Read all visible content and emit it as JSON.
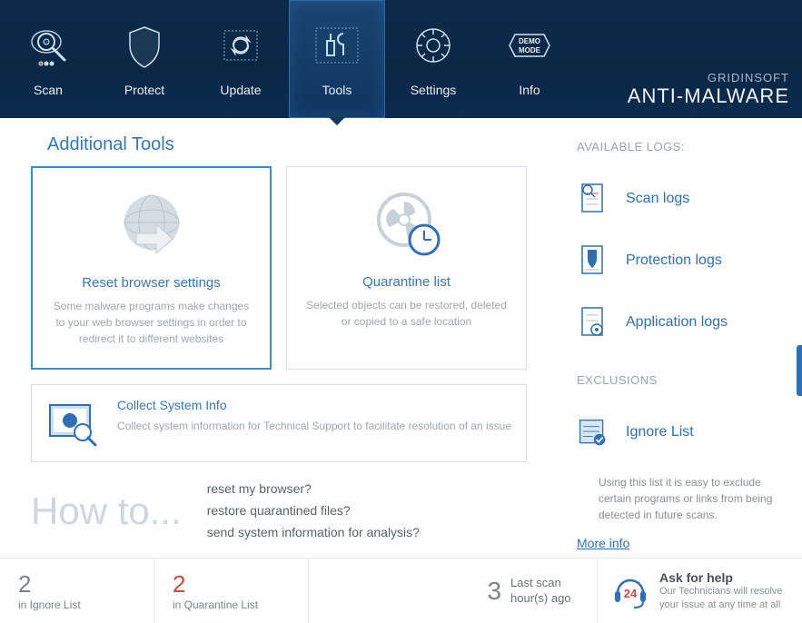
{
  "brand": {
    "company": "GRIDINSOFT",
    "product": "ANTI-MALWARE"
  },
  "nav": [
    {
      "label": "Scan"
    },
    {
      "label": "Protect"
    },
    {
      "label": "Update"
    },
    {
      "label": "Tools",
      "active": true
    },
    {
      "label": "Settings"
    },
    {
      "label": "Info"
    }
  ],
  "page": {
    "title": "Additional Tools"
  },
  "cards": {
    "reset": {
      "title": "Reset browser settings",
      "desc": "Some malware programs make changes to your web browser settings in order to redirect it to different websites"
    },
    "quarantine": {
      "title": "Quarantine list",
      "desc": "Selected objects can be restored, deleted or copied to a safe location"
    },
    "collect": {
      "title": "Collect System Info",
      "desc": "Collect system information for Technical Support to facilitate resolution of an issue"
    }
  },
  "howto": {
    "heading": "How to...",
    "items": [
      "reset my browser?",
      "restore quarantined files?",
      "send system information for analysis?"
    ]
  },
  "logs": {
    "heading": "AVAILABLE LOGS:",
    "items": [
      "Scan logs",
      "Protection logs",
      "Application logs"
    ]
  },
  "exclusions": {
    "heading": "EXCLUSIONS",
    "link": "Ignore List",
    "desc": "Using this list it is easy to exclude certain programs or links from being detected in future scans.",
    "more": "More info"
  },
  "footer": {
    "ignore": {
      "value": "2",
      "label": "in Ignore List"
    },
    "quarantine": {
      "value": "2",
      "label": "in Quarantine List"
    },
    "lastscan": {
      "value": "3",
      "line1": "Last scan",
      "line2": "hour(s) ago"
    },
    "ask": {
      "title": "Ask for help",
      "desc": "Our Technicians will resolve your issue at any time at all"
    }
  }
}
